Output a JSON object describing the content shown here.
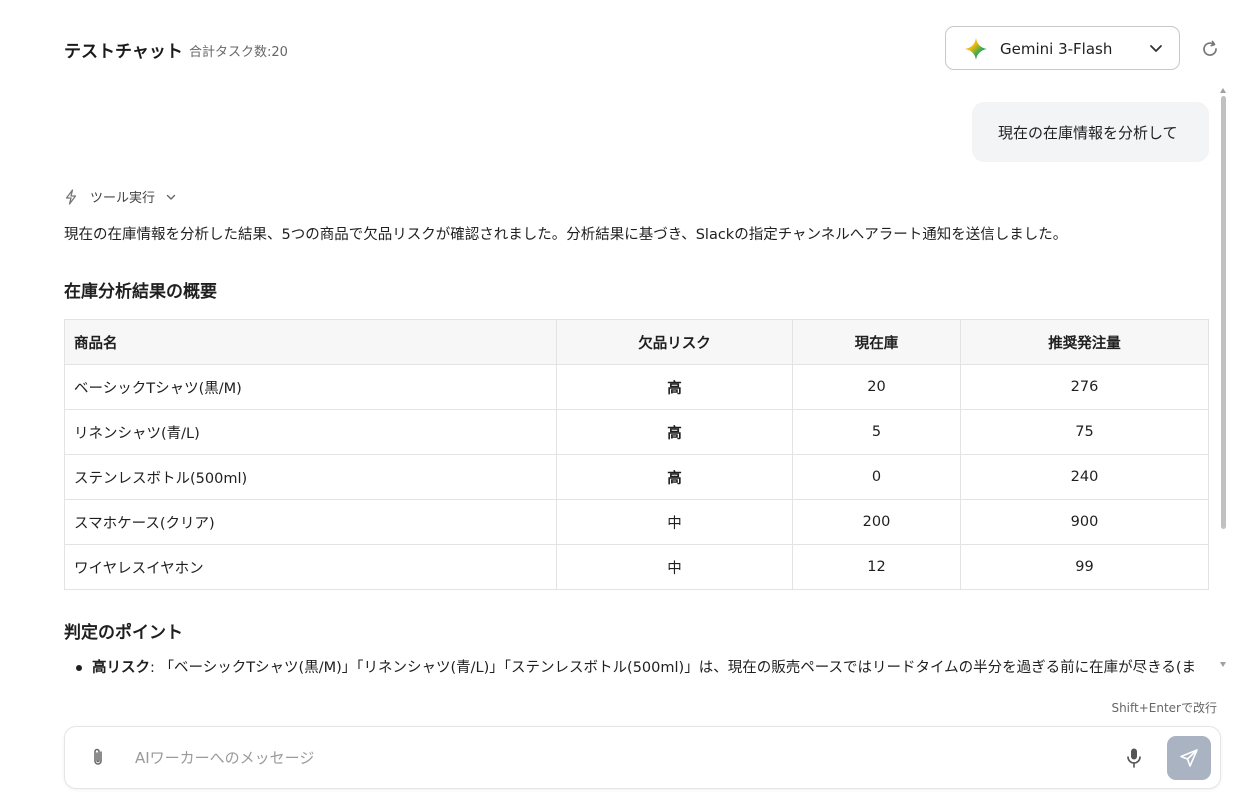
{
  "header": {
    "title": "テストチャット",
    "task_count": "合計タスク数:20",
    "model": "Gemini 3-Flash"
  },
  "chat": {
    "user_message": "現在の在庫情報を分析して",
    "tool_label": "ツール実行",
    "summary": "現在の在庫情報を分析した結果、5つの商品で欠品リスクが確認されました。分析結果に基づき、Slackの指定チャンネルへアラート通知を送信しました。",
    "section1_title": "在庫分析結果の概要",
    "table": {
      "headers": [
        "商品名",
        "欠品リスク",
        "現在庫",
        "推奨発注量"
      ],
      "rows": [
        [
          "ベーシックTシャツ(黒/M)",
          "高",
          "20",
          "276"
        ],
        [
          "リネンシャツ(青/L)",
          "高",
          "5",
          "75"
        ],
        [
          "ステンレスボトル(500ml)",
          "高",
          "0",
          "240"
        ],
        [
          "スマホケース(クリア)",
          "中",
          "200",
          "900"
        ],
        [
          "ワイヤレスイヤホン",
          "中",
          "12",
          "99"
        ]
      ]
    },
    "section2_title": "判定のポイント",
    "bullet_label": "高リスク",
    "bullet_text": ": 「ベーシックTシャツ(黒/M)」「リネンシャツ(青/L)」「ステンレスボトル(500ml)」は、現在の販売ペースではリードタイムの半分を過ぎる前に在庫が尽きる(ま"
  },
  "composer": {
    "hint": "Shift+Enterで改行",
    "placeholder": "AIワーカーへのメッセージ"
  },
  "colors": {
    "send_button": "#a9b3c2",
    "table_header_bg": "#f7f7f8",
    "bubble_bg": "#f3f4f6"
  },
  "icons": [
    "gemini-sparkle-icon",
    "chevron-down-icon",
    "refresh-icon",
    "bolt-icon",
    "paperclip-icon",
    "microphone-icon",
    "send-icon"
  ]
}
